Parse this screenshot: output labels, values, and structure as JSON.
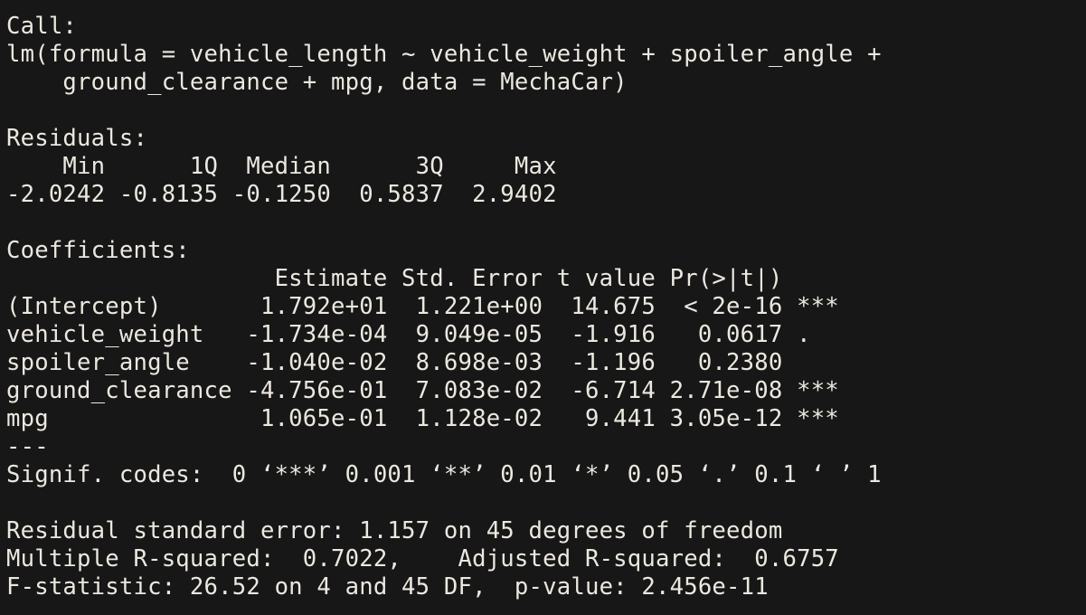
{
  "call": {
    "label": "Call:",
    "line1": "lm(formula = vehicle_length ~ vehicle_weight + spoiler_angle + ",
    "line2": "    ground_clearance + mpg, data = MechaCar)"
  },
  "residuals": {
    "label": "Residuals:",
    "header": "    Min      1Q  Median      3Q     Max ",
    "values": "-2.0242 -0.8135 -0.1250  0.5837  2.9402 "
  },
  "coefficients": {
    "label": "Coefficients:",
    "header": "                   Estimate Std. Error t value Pr(>|t|)    ",
    "rows": [
      "(Intercept)       1.792e+01  1.221e+00  14.675  < 2e-16 ***",
      "vehicle_weight   -1.734e-04  9.049e-05  -1.916   0.0617 .  ",
      "spoiler_angle    -1.040e-02  8.698e-03  -1.196   0.2380    ",
      "ground_clearance -4.756e-01  7.083e-02  -6.714 2.71e-08 ***",
      "mpg               1.065e-01  1.128e-02   9.441 3.05e-12 ***"
    ],
    "separator": "---",
    "signif_codes": "Signif. codes:  0 ‘***’ 0.001 ‘**’ 0.01 ‘*’ 0.05 ‘.’ 0.1 ‘ ’ 1"
  },
  "summary": {
    "residual_se": "Residual standard error: 1.157 on 45 degrees of freedom",
    "r_squared": "Multiple R-squared:  0.7022,    Adjusted R-squared:  0.6757 ",
    "f_statistic": "F-statistic: 26.52 on 4 and 45 DF,  p-value: 2.456e-11"
  },
  "colors": {
    "background": "#171717",
    "text": "#ece8e0"
  }
}
